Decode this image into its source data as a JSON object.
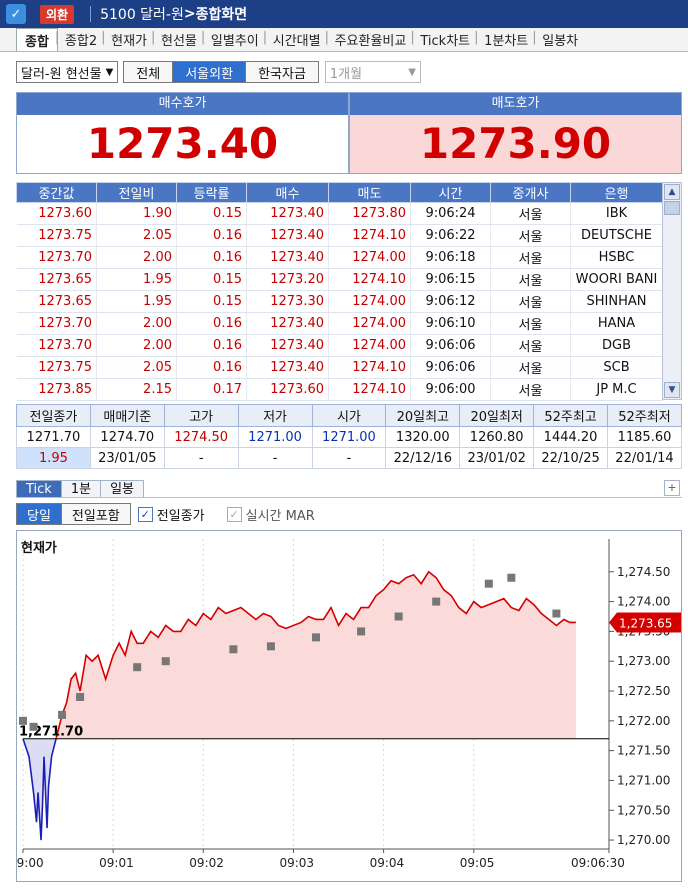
{
  "titlebar": {
    "icon": "✓",
    "badge": "외환",
    "code": "5100 달러-원",
    "arrow": ">",
    "subtitle": "종합화면"
  },
  "tabs": [
    "종합",
    "종합2",
    "현재가",
    "현선물",
    "일별추이",
    "시간대별",
    "주요환율비교",
    "Tick차트",
    "1분차트",
    "일봉차"
  ],
  "controls": {
    "instrument": "달러-원 현선물",
    "segments": [
      "전체",
      "서울외환",
      "한국자금"
    ],
    "active_segment": 1,
    "period": "1개월"
  },
  "quotes": {
    "bid_label": "매수호가",
    "bid_price": "1273.40",
    "ask_label": "매도호가",
    "ask_price": "1273.90"
  },
  "trades": {
    "headers": [
      "중간값",
      "전일비",
      "등락률",
      "매수",
      "매도",
      "시간",
      "중개사",
      "은행"
    ],
    "rows": [
      [
        "1273.60",
        "1.90",
        "0.15",
        "1273.40",
        "1273.80",
        "9:06:24",
        "서울",
        "IBK"
      ],
      [
        "1273.75",
        "2.05",
        "0.16",
        "1273.40",
        "1274.10",
        "9:06:22",
        "서울",
        "DEUTSCHE"
      ],
      [
        "1273.70",
        "2.00",
        "0.16",
        "1273.40",
        "1274.00",
        "9:06:18",
        "서울",
        "HSBC"
      ],
      [
        "1273.65",
        "1.95",
        "0.15",
        "1273.20",
        "1274.10",
        "9:06:15",
        "서울",
        "WOORI BANI"
      ],
      [
        "1273.65",
        "1.95",
        "0.15",
        "1273.30",
        "1274.00",
        "9:06:12",
        "서울",
        "SHINHAN"
      ],
      [
        "1273.70",
        "2.00",
        "0.16",
        "1273.40",
        "1274.00",
        "9:06:10",
        "서울",
        "HANA"
      ],
      [
        "1273.70",
        "2.00",
        "0.16",
        "1273.40",
        "1274.00",
        "9:06:06",
        "서울",
        "DGB"
      ],
      [
        "1273.75",
        "2.05",
        "0.16",
        "1273.40",
        "1274.10",
        "9:06:06",
        "서울",
        "SCB"
      ],
      [
        "1273.85",
        "2.15",
        "0.17",
        "1273.60",
        "1274.10",
        "9:06:00",
        "서울",
        "JP M.C"
      ]
    ]
  },
  "summary": {
    "headers": [
      "전일종가",
      "매매기준",
      "고가",
      "저가",
      "시가",
      "20일최고",
      "20일최저",
      "52주최고",
      "52주최저"
    ],
    "row1": [
      "1271.70",
      "1274.70",
      "1274.50",
      "1271.00",
      "1271.00",
      "1320.00",
      "1260.80",
      "1444.20",
      "1185.60"
    ],
    "row2": [
      "1.95",
      "23/01/05",
      "-",
      "-",
      "-",
      "22/12/16",
      "23/01/02",
      "22/10/25",
      "22/01/14"
    ]
  },
  "chart_tabs": [
    "Tick",
    "1분",
    "일봉"
  ],
  "chart_options": {
    "buttons": [
      "당일",
      "전일포함"
    ],
    "check_prev_close": "전일종가",
    "check_realtime": "실시간 MAR",
    "plus": "+"
  },
  "chart_data": {
    "type": "line",
    "title": "현재가",
    "prev_close": 1271.7,
    "prev_close_label": "1,271.70",
    "last_label": "1,273.65",
    "ylim": [
      1269.85,
      1275.05
    ],
    "y_ticks": [
      "1,274.50",
      "1,274.00",
      "1,273.50",
      "1,273.00",
      "1,272.50",
      "1,272.00",
      "1,271.50",
      "1,271.00",
      "1,270.50",
      "1,270.00"
    ],
    "y_tick_values": [
      1274.5,
      1274.0,
      1273.5,
      1273.0,
      1272.5,
      1272.0,
      1271.5,
      1271.0,
      1270.5,
      1270.0
    ],
    "x_ticks": [
      "09:00",
      "09:01",
      "09:02",
      "09:03",
      "09:04",
      "09:05",
      "09:06:30"
    ],
    "x_tick_values": [
      0,
      60,
      120,
      180,
      240,
      300,
      390
    ],
    "x_range": [
      0,
      390
    ],
    "colors": {
      "line": "#d40000",
      "fill": "#fbdada",
      "below_line": "#1a1fb8",
      "below_fill": "#dcdcf5",
      "marker": "#777777"
    },
    "x": [
      0,
      4,
      7,
      9,
      10,
      12,
      13,
      14,
      16,
      17,
      19,
      21,
      23,
      26,
      29,
      32,
      35,
      38,
      42,
      46,
      50,
      55,
      60,
      64,
      68,
      72,
      76,
      80,
      85,
      90,
      95,
      100,
      105,
      110,
      115,
      120,
      125,
      130,
      135,
      140,
      145,
      150,
      155,
      160,
      165,
      170,
      175,
      180,
      185,
      190,
      195,
      200,
      205,
      210,
      215,
      220,
      225,
      230,
      235,
      240,
      245,
      250,
      255,
      260,
      265,
      270,
      275,
      280,
      285,
      290,
      295,
      300,
      305,
      310,
      315,
      320,
      325,
      330,
      335,
      340,
      345,
      350,
      355,
      360,
      364,
      368
    ],
    "y": [
      1271.7,
      1271.4,
      1270.8,
      1270.3,
      1270.8,
      1270.0,
      1270.6,
      1271.4,
      1270.2,
      1270.9,
      1271.4,
      1271.6,
      1271.8,
      1272.1,
      1272.3,
      1272.7,
      1272.8,
      1272.5,
      1273.1,
      1273.0,
      1273.1,
      1272.7,
      1273.1,
      1273.3,
      1273.1,
      1273.5,
      1273.3,
      1273.3,
      1273.5,
      1273.4,
      1273.6,
      1273.5,
      1273.5,
      1273.7,
      1273.6,
      1273.8,
      1273.7,
      1273.9,
      1273.8,
      1273.85,
      1273.9,
      1273.8,
      1273.7,
      1273.8,
      1273.75,
      1273.6,
      1273.55,
      1273.6,
      1273.65,
      1273.75,
      1273.7,
      1273.7,
      1273.9,
      1273.6,
      1273.8,
      1273.7,
      1273.9,
      1273.9,
      1274.1,
      1274.2,
      1274.35,
      1274.3,
      1274.4,
      1274.45,
      1274.3,
      1274.5,
      1274.4,
      1274.2,
      1274.1,
      1273.9,
      1273.8,
      1274.0,
      1273.9,
      1273.95,
      1274.0,
      1274.05,
      1273.9,
      1273.85,
      1274.05,
      1273.95,
      1273.8,
      1273.7,
      1273.6,
      1273.7,
      1273.65,
      1273.65
    ],
    "marker_x": [
      0,
      7,
      26,
      38,
      76,
      95,
      140,
      165,
      195,
      225,
      250,
      275,
      310,
      325,
      355
    ],
    "marker_y": [
      1272.0,
      1271.9,
      1272.1,
      1272.4,
      1272.9,
      1273.0,
      1273.2,
      1273.25,
      1273.4,
      1273.5,
      1273.75,
      1274.0,
      1274.3,
      1274.4,
      1273.8
    ]
  }
}
